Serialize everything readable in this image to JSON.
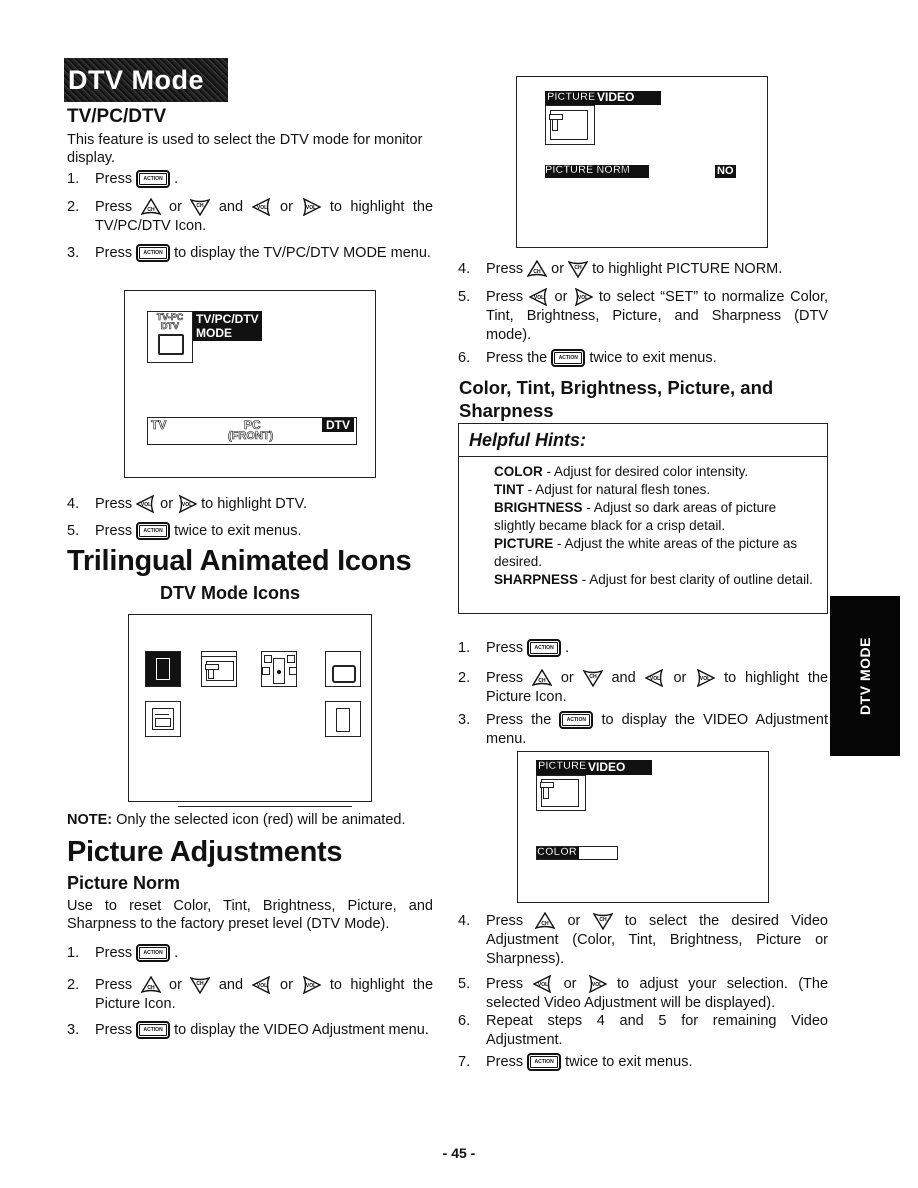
{
  "page": {
    "banner": "DTV Mode",
    "side_tab": "DTV MODE",
    "page_number": "- 45 -"
  },
  "buttons": {
    "action": "ACTION",
    "ch_up": "CH",
    "ch_down": "CH",
    "vol_left": "VOL",
    "vol_right": "VOL"
  },
  "tvpcdtv": {
    "heading": "TV/PC/DTV",
    "intro": "This feature is used to select the DTV mode for monitor display.",
    "steps": [
      {
        "num": "1.",
        "pre": "Press",
        "post": "."
      },
      {
        "num": "2.",
        "pre": "Press",
        "or1": "or",
        "and": "and",
        "or2": "or",
        "post": "to highlight the TV/PC/DTV Icon."
      },
      {
        "num": "3.",
        "pre": "Press",
        "post": "to display the TV/PC/DTV MODE menu."
      },
      {
        "num": "4.",
        "pre": "Press",
        "or1": "or",
        "post": "to highlight DTV."
      },
      {
        "num": "5.",
        "pre": "Press",
        "post": "twice to exit menus."
      }
    ],
    "screen": {
      "icon_label_line1": "TV-PC",
      "icon_label_line2": "DTV",
      "title_line1": "TV/PC/DTV",
      "title_line2": "MODE",
      "options": [
        "TV",
        "PC",
        "DTV"
      ],
      "pc_sub": "(FRONT)",
      "selected": "DTV"
    }
  },
  "trilingual": {
    "heading": "Trilingual Animated Icons",
    "subheading": "DTV Mode Icons",
    "icons": [
      "exit-door-selected",
      "picture",
      "audio",
      "tv-pc-dtv",
      "setup",
      "exit-door"
    ],
    "note_label": "NOTE:",
    "note_text": "Only the selected icon (red) will be animated."
  },
  "picture_adj": {
    "heading": "Picture Adjustments",
    "subheading": "Picture Norm",
    "intro": "Use to reset Color, Tint, Brightness, Picture, and Sharpness to the factory preset level (DTV Mode).",
    "steps": [
      {
        "num": "1.",
        "pre": "Press",
        "post": "."
      },
      {
        "num": "2.",
        "pre": "Press",
        "or1": "or",
        "and": "and",
        "or2": "or",
        "post": "to highlight the Picture Icon."
      },
      {
        "num": "3.",
        "pre": "Press",
        "post": "to display the VIDEO Adjustment menu."
      },
      {
        "num": "4.",
        "pre": "Press",
        "or1": "or",
        "post": "to highlight PICTURE NORM."
      },
      {
        "num": "5.",
        "pre": "Press",
        "or1": "or",
        "post": "to select “SET” to normalize Color, Tint, Brightness, Picture, and Sharpness (DTV mode)."
      },
      {
        "num": "6.",
        "pre": "Press the",
        "post": "twice to exit menus."
      }
    ],
    "screen": {
      "tab1": "PICTURE",
      "tab2": "VIDEO",
      "item": "PICTURE NORM",
      "value": "NO"
    }
  },
  "color_tint": {
    "heading": "Color, Tint, Brightness, Picture, and Sharpness",
    "hints_title": "Helpful Hints:",
    "hints": [
      {
        "term": "COLOR",
        "text": " - Adjust for desired color intensity."
      },
      {
        "term": "TINT",
        "text": " - Adjust for natural flesh tones."
      },
      {
        "term": "BRIGHTNESS",
        "text": " - Adjust so dark areas of picture slightly became black for a crisp detail."
      },
      {
        "term": "PICTURE",
        "text": " - Adjust the white areas of the picture as desired."
      },
      {
        "term": "SHARPNESS",
        "text": " - Adjust for best clarity of outline detail."
      }
    ],
    "steps": [
      {
        "num": "1.",
        "pre": "Press",
        "post": "."
      },
      {
        "num": "2.",
        "pre": "Press",
        "or1": "or",
        "and": "and",
        "or2": "or",
        "post": "to highlight the Picture Icon."
      },
      {
        "num": "3.",
        "pre": "Press the",
        "post": "to display the VIDEO Adjustment menu."
      },
      {
        "num": "4.",
        "pre": "Press",
        "or1": "or",
        "post": "to select the desired Video Adjustment (Color, Tint, Brightness, Picture or Sharpness)."
      },
      {
        "num": "5.",
        "pre": "Press",
        "or1": "or",
        "post": "to adjust your selection. (The selected Video Adjustment will be displayed)."
      },
      {
        "num": "6.",
        "post": "Repeat steps 4 and 5 for remaining Video Adjustment."
      },
      {
        "num": "7.",
        "pre": "Press",
        "post": "twice to exit menus."
      }
    ],
    "screen": {
      "tab1": "PICTURE",
      "tab2": "VIDEO",
      "item": "COLOR"
    }
  }
}
